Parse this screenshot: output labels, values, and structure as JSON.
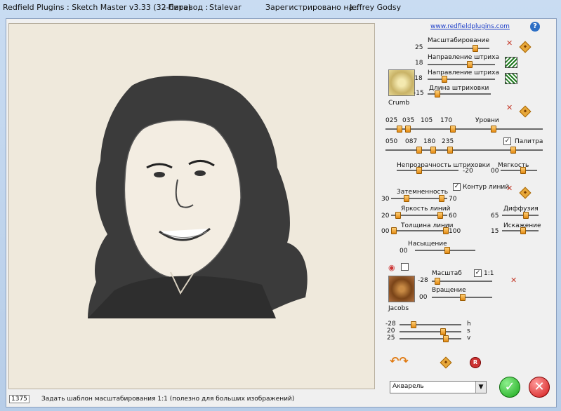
{
  "title": {
    "app": "Redfield Plugins : Sketch Master v3.33 (32-бита)",
    "translation_label": "- Перевод :",
    "translator": "Stalevar",
    "registered_label": "Зарегистрировано на :",
    "registered_to": "Jeffrey Godsy"
  },
  "panel": {
    "link": "www.redfieldplugins.com",
    "help": "?",
    "scale_label": "Масштабирование",
    "scale_value": "25",
    "stroke_dir1_label": "Направление штриха",
    "stroke_dir1_value": "18",
    "stroke_dir2_label": "Направление штриха",
    "stroke_dir2_value": "-18",
    "hatch_len_label": "Длина штриховки",
    "hatch_len_value": "-15",
    "texture1_name": "Crumb",
    "levels_label": "Уровни",
    "levels_top": [
      "025",
      "035",
      "105",
      "170"
    ],
    "levels_bottom": [
      "050",
      "087",
      "180",
      "235"
    ],
    "palette_label": "Палитра",
    "palette_checked": "✓",
    "hatch_opacity_label": "Непрозрачность штриховки",
    "hatch_opacity_value": "-20",
    "softness_label": "Мягкость",
    "softness_value": "00",
    "line_contour_label": "Контур линий",
    "line_contour_checked": "✓",
    "darkness_label": "Затемненность",
    "darkness_min": "30",
    "darkness_max": "70",
    "line_brightness_label": "Яркость линий",
    "line_brightness_min": "20",
    "line_brightness_max": "60",
    "diffusion_label": "Диффузия",
    "diffusion_value": "65",
    "line_width_label": "Толщина линии",
    "line_width_min": "00",
    "line_width_max": "100",
    "distortion_label": "Искажение",
    "distortion_value": "15",
    "saturation_label": "Насыщение",
    "saturation_value": "00",
    "tex_scale_label": "Масштаб",
    "tex_scale_value": "-28",
    "one_to_one_label": "1:1",
    "one_to_one_checked": "✓",
    "rotation_label": "Вращение",
    "rotation_value": "00",
    "texture2_name": "Jacobs",
    "h_value": "-28",
    "h_label": "h",
    "s_value": "20",
    "s_label": "s",
    "v_value": "25",
    "v_label": "v",
    "reset_label": "R",
    "preset": "Акварель"
  },
  "status": {
    "size": "1375",
    "message": "Задать шаблон масштабирования 1:1 (полезно для больших изображений)"
  }
}
